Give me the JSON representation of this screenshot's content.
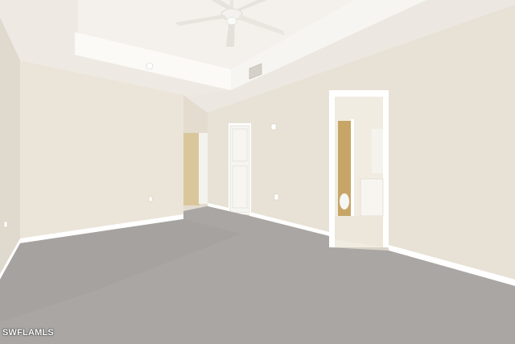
{
  "watermark": {
    "text": "SWFLAMLS"
  },
  "palette": {
    "wall_light": "#ece7dc",
    "wall_shadow": "#dcd5c8",
    "ceiling": "#f1eee8",
    "trim": "#ffffff",
    "carpet": "#a8a5a2",
    "carpet_dark": "#9b9895",
    "tile": "#efe9df",
    "bath_wall": "#c9a86a",
    "door": "#f7f6f3"
  },
  "objects": [
    "ceiling-fan",
    "tray-ceiling",
    "hvac-vent",
    "smoke-detector",
    "closet-door",
    "hallway-opening",
    "bathroom-doorway",
    "carpet-floor",
    "baseboards",
    "wall-outlets",
    "thermostat"
  ]
}
